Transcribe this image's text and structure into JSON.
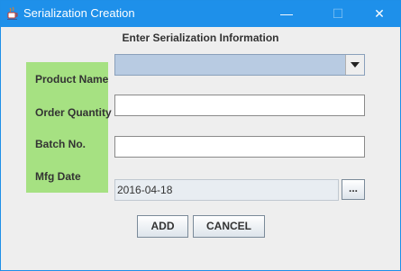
{
  "window": {
    "title": "Serialization Creation",
    "icon": "java-coffee-cup-icon",
    "controls": {
      "minimize_glyph": "—",
      "maximize_glyph": "☐",
      "close_glyph": "✕"
    }
  },
  "form": {
    "heading": "Enter Serialization Information",
    "labels": {
      "product_name": "Product Name",
      "order_quantity": "Order Quantity",
      "batch_no": "Batch No.",
      "mfg_date": "Mfg Date"
    },
    "product_name_selected": "",
    "order_quantity_value": "",
    "batch_no_value": "",
    "mfg_date_value": "2016-04-18",
    "date_picker_label": "...",
    "label_panel_color": "#a6e182"
  },
  "buttons": {
    "add": "ADD",
    "cancel": "CANCEL"
  },
  "colors": {
    "titlebar": "#1e90ea",
    "combo_background": "#b8cbe2",
    "window_background": "#eeeeee"
  }
}
